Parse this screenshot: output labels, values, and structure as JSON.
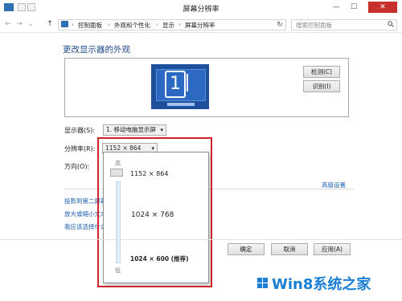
{
  "window": {
    "title": "屏幕分辨率",
    "minimize": "—",
    "maximize": "☐",
    "close": "✕"
  },
  "navigation": {
    "back": "←",
    "forward": "→",
    "dropdown": "⌄",
    "up": "↑",
    "breadcrumbs": [
      "控制面板",
      "外观和个性化",
      "显示",
      "屏幕分辨率"
    ],
    "separator": "›",
    "refresh": "↻",
    "search_placeholder": "搜索控制面板",
    "search_icon": "search-icon"
  },
  "main": {
    "title": "更改显示器的外观",
    "monitor_number": "1",
    "detect_button": "检测(C)",
    "identify_button": "识别(I)",
    "display_label": "显示器(S):",
    "display_value": "1. 移动电脑显示屏",
    "resolution_label": "分辨率(R):",
    "resolution_value": "1152 × 864",
    "orientation_label": "方向(O):",
    "advanced_link": "高级设置",
    "links": [
      "投影到第二屏幕",
      "放大或缩小文本和其他项目",
      "我应该选择什么显示器设置?"
    ]
  },
  "resolution_dropdown": {
    "high_label": "高",
    "low_label": "低",
    "options": [
      "1152 × 864",
      "1024 × 768",
      "1024 × 600 (推荐)"
    ]
  },
  "footer": {
    "ok": "确定",
    "cancel": "取消",
    "apply": "应用(A)"
  },
  "watermark": {
    "text": "Win8系统之家"
  },
  "colors": {
    "accent": "#1d4f9c",
    "highlight_box": "#d2232a",
    "link": "#1a5fb4",
    "watermark": "#1b7fd6"
  }
}
